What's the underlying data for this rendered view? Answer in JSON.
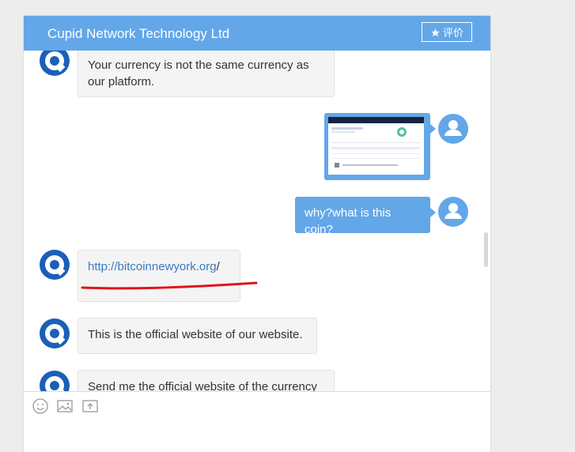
{
  "window": {
    "title": "Cupid Network Technology Ltd",
    "rate_button": "评价",
    "colors": {
      "header": "#63a7e8",
      "agent_bubble": "#f4f4f4",
      "user_bubble": "#63a7e8",
      "link": "#3a7bbf",
      "annotation": "#e0141a"
    }
  },
  "messages": [
    {
      "sender": "agent",
      "lines": [
        "Your currency is not the same currency as",
        "our platform."
      ]
    },
    {
      "sender": "user",
      "type": "image",
      "alt": "screenshot"
    },
    {
      "sender": "user",
      "text": "why?what is this coin?"
    },
    {
      "sender": "agent",
      "link": "http://bitcoinnewyork.org",
      "link_suffix": "/"
    },
    {
      "sender": "agent",
      "text": "This is the official website of our website."
    },
    {
      "sender": "agent",
      "text": "Send me the official website of the currency"
    }
  ],
  "toolbar": {
    "icons": [
      "emoji-icon",
      "image-icon",
      "upload-icon"
    ]
  }
}
